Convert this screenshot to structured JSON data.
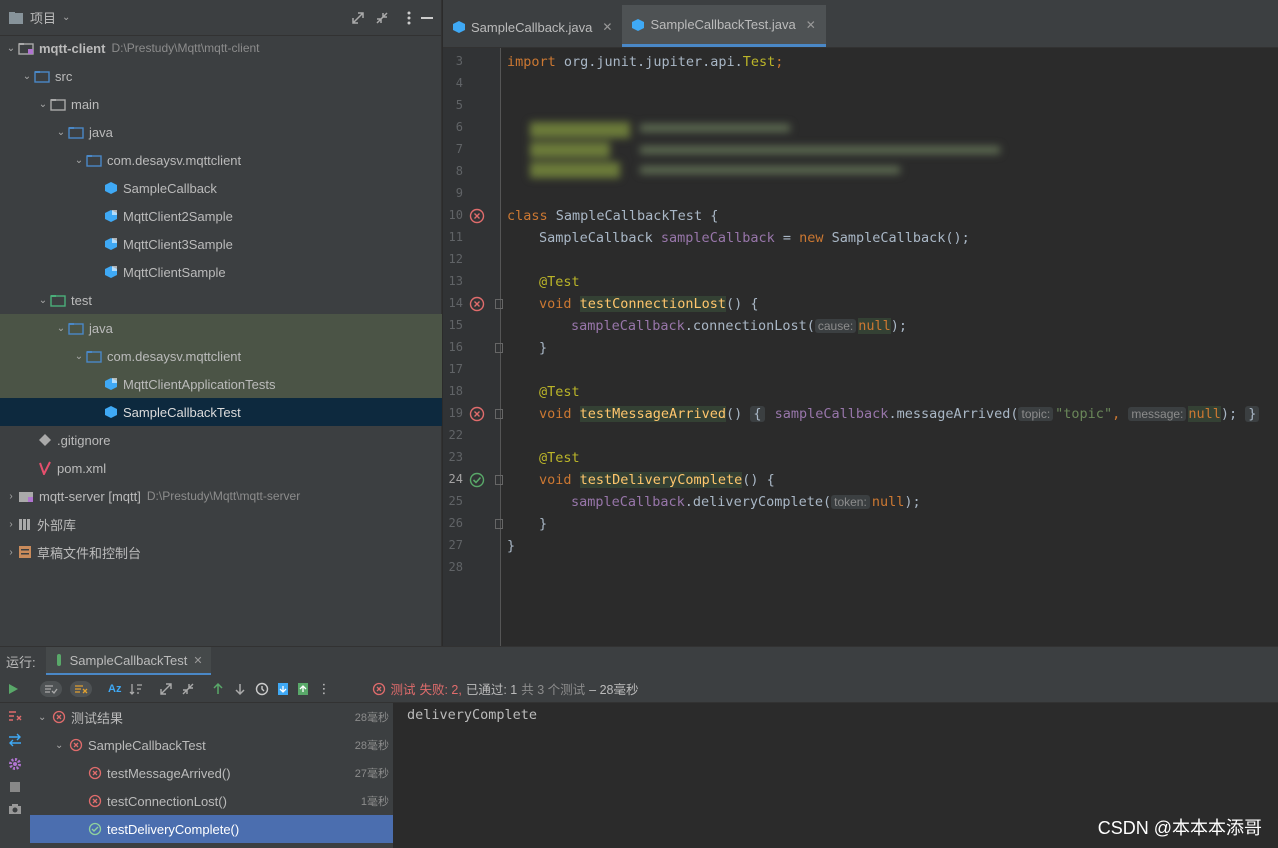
{
  "project_panel": {
    "title": "项目",
    "tree": [
      {
        "label": "mqtt-client",
        "path": "D:\\Prestudy\\Mqtt\\mqtt-client"
      },
      {
        "label": "src"
      },
      {
        "label": "main"
      },
      {
        "label": "java"
      },
      {
        "label": "com.desaysv.mqttclient"
      },
      {
        "label": "SampleCallback"
      },
      {
        "label": "MqttClient2Sample"
      },
      {
        "label": "MqttClient3Sample"
      },
      {
        "label": "MqttClientSample"
      },
      {
        "label": "test"
      },
      {
        "label": "java"
      },
      {
        "label": "com.desaysv.mqttclient"
      },
      {
        "label": "MqttClientApplicationTests"
      },
      {
        "label": "SampleCallbackTest"
      },
      {
        "label": ".gitignore"
      },
      {
        "label": "pom.xml"
      },
      {
        "label": "mqtt-server [mqtt]",
        "path": "D:\\Prestudy\\Mqtt\\mqtt-server"
      },
      {
        "label": "外部库"
      },
      {
        "label": "草稿文件和控制台"
      }
    ]
  },
  "editor": {
    "tabs": [
      {
        "label": "SampleCallback.java"
      },
      {
        "label": "SampleCallbackTest.java"
      }
    ],
    "line_numbers": [
      "3",
      "4",
      "5",
      "6",
      "7",
      "8",
      "9",
      "10",
      "11",
      "12",
      "13",
      "14",
      "15",
      "16",
      "17",
      "18",
      "19",
      "22",
      "23",
      "24",
      "25",
      "26",
      "27",
      "28"
    ],
    "code": {
      "l3_kw": "import",
      "l3_pkg": " org.junit.jupiter.api.",
      "l3_cls": "Test",
      "l3_semi": ";",
      "l10_kw": "class",
      "l10_rest": " SampleCallbackTest {",
      "l11_type": "SampleCallback ",
      "l11_field": "sampleCallback",
      "l11_eq": " = ",
      "l11_new": "new",
      "l11_rest": " SampleCallback();",
      "ann": "@Test",
      "void": "void",
      "m1": "testConnectionLost",
      "m1_rest": "() {",
      "c1_field": "sampleCallback",
      "c1_call": ".connectionLost(",
      "c1_hint": "cause:",
      "null": "null",
      "c1_end": ");",
      "close_brace": "}",
      "m2": "testMessageArrived",
      "m2_rest": "() ",
      "m2_open": "{",
      "c2_field": "sampleCallback",
      "c2_call": ".messageArrived(",
      "c2_hint1": "topic:",
      "c2_str": "\"topic\"",
      "c2_comma": ", ",
      "c2_hint2": "message:",
      "c2_end": ");",
      "m3": "testDeliveryComplete",
      "m3_rest": "() {",
      "c3_field": "sampleCallback",
      "c3_call": ".deliveryComplete(",
      "c3_hint": "token:",
      "c3_end": ");"
    }
  },
  "run_panel": {
    "label": "运行:",
    "tab": "SampleCallbackTest",
    "status": {
      "label": "测试",
      "failed": "失败: 2,",
      "passed": "已通过: 1",
      "total": "共 3 个测试",
      "time": "– 28毫秒"
    },
    "results": [
      {
        "name": "测试结果",
        "time": "28毫秒"
      },
      {
        "name": "SampleCallbackTest",
        "time": "28毫秒"
      },
      {
        "name": "testMessageArrived()",
        "time": "27毫秒"
      },
      {
        "name": "testConnectionLost()",
        "time": "1毫秒"
      },
      {
        "name": "testDeliveryComplete()",
        "time": ""
      }
    ],
    "console_output": "deliveryComplete"
  },
  "watermark": "CSDN @本本本添哥",
  "colors": {
    "accent": "#4a88c7",
    "error": "#e06c6c",
    "success": "#59a869",
    "selection": "#0d293e"
  }
}
